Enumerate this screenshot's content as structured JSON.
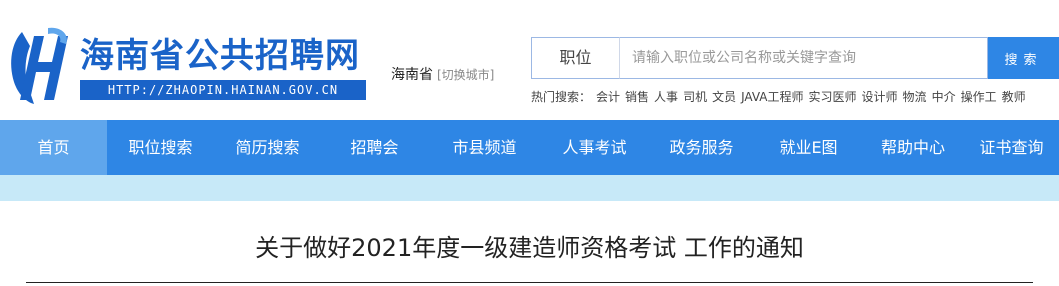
{
  "site": {
    "title": "海南省公共招聘网",
    "url": "HTTP://ZHAOPIN.HAINAN.GOV.CN",
    "brand_color": "#1a63c8"
  },
  "city": {
    "name": "海南省",
    "switch_label": "[切换城市]"
  },
  "search": {
    "category": "职位",
    "placeholder": "请输入职位或公司名称或关键字查询",
    "button_label": "搜索"
  },
  "hot": {
    "label": "热门搜索：",
    "items": [
      "会计",
      "销售",
      "人事",
      "司机",
      "文员",
      "JAVA工程师",
      "实习医师",
      "设计师",
      "物流",
      "中介",
      "操作工",
      "教师"
    ]
  },
  "nav": {
    "items": [
      {
        "label": "首页"
      },
      {
        "label": "职位搜索"
      },
      {
        "label": "简历搜索"
      },
      {
        "label": "招聘会"
      },
      {
        "label": "市县频道"
      },
      {
        "label": "人事考试"
      },
      {
        "label": "政务服务"
      },
      {
        "label": "就业E图"
      },
      {
        "label": "帮助中心"
      },
      {
        "label": "证书查询"
      }
    ],
    "color": "#2e86e5",
    "active_color": "#5fa6ec"
  },
  "article": {
    "title": "关于做好2021年度一级建造师资格考试 工作的通知"
  }
}
